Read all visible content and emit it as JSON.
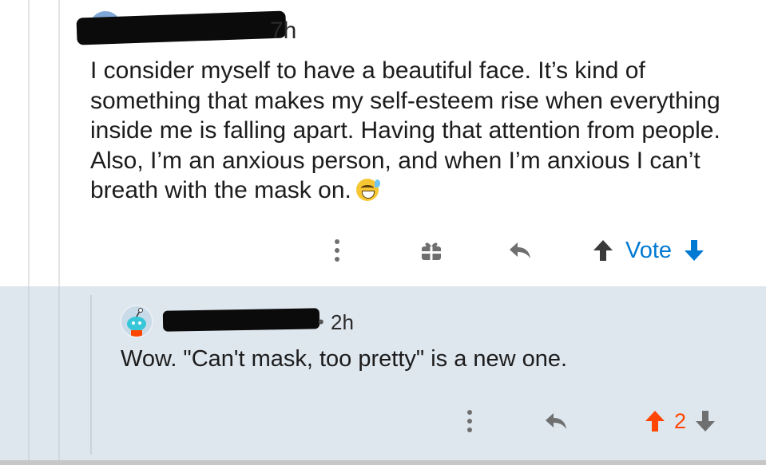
{
  "parent": {
    "age_tail": "7h",
    "body": "I consider myself to have a beautiful face. It’s kind of something that makes my self-esteem rise when everything inside me is falling apart. Having that attention from people. Also, I’m an anxious person, and when I’m anxious I can’t breath with the mask on.",
    "emoji_icon": "sweat-smile-emoji",
    "actions": {
      "more_icon": "more-vertical-icon",
      "award_icon": "gift-award-icon",
      "reply_icon": "reply-arrow-icon",
      "upvote_icon": "upvote-arrow-icon",
      "vote_label": "Vote",
      "downvote_icon": "downvote-arrow-icon"
    }
  },
  "reply": {
    "separator": "•",
    "age": "2h",
    "body": "Wow. \"Can't mask, too pretty\" is a new one.",
    "actions": {
      "more_icon": "more-vertical-icon",
      "reply_icon": "reply-arrow-icon",
      "upvote_icon": "upvote-arrow-icon",
      "score": "2",
      "downvote_icon": "downvote-arrow-icon"
    }
  },
  "colors": {
    "blue": "#0079d3",
    "orange": "#ff4500",
    "reply_bg": "#dee6ee",
    "icon_gray": "#6f6f6f"
  }
}
